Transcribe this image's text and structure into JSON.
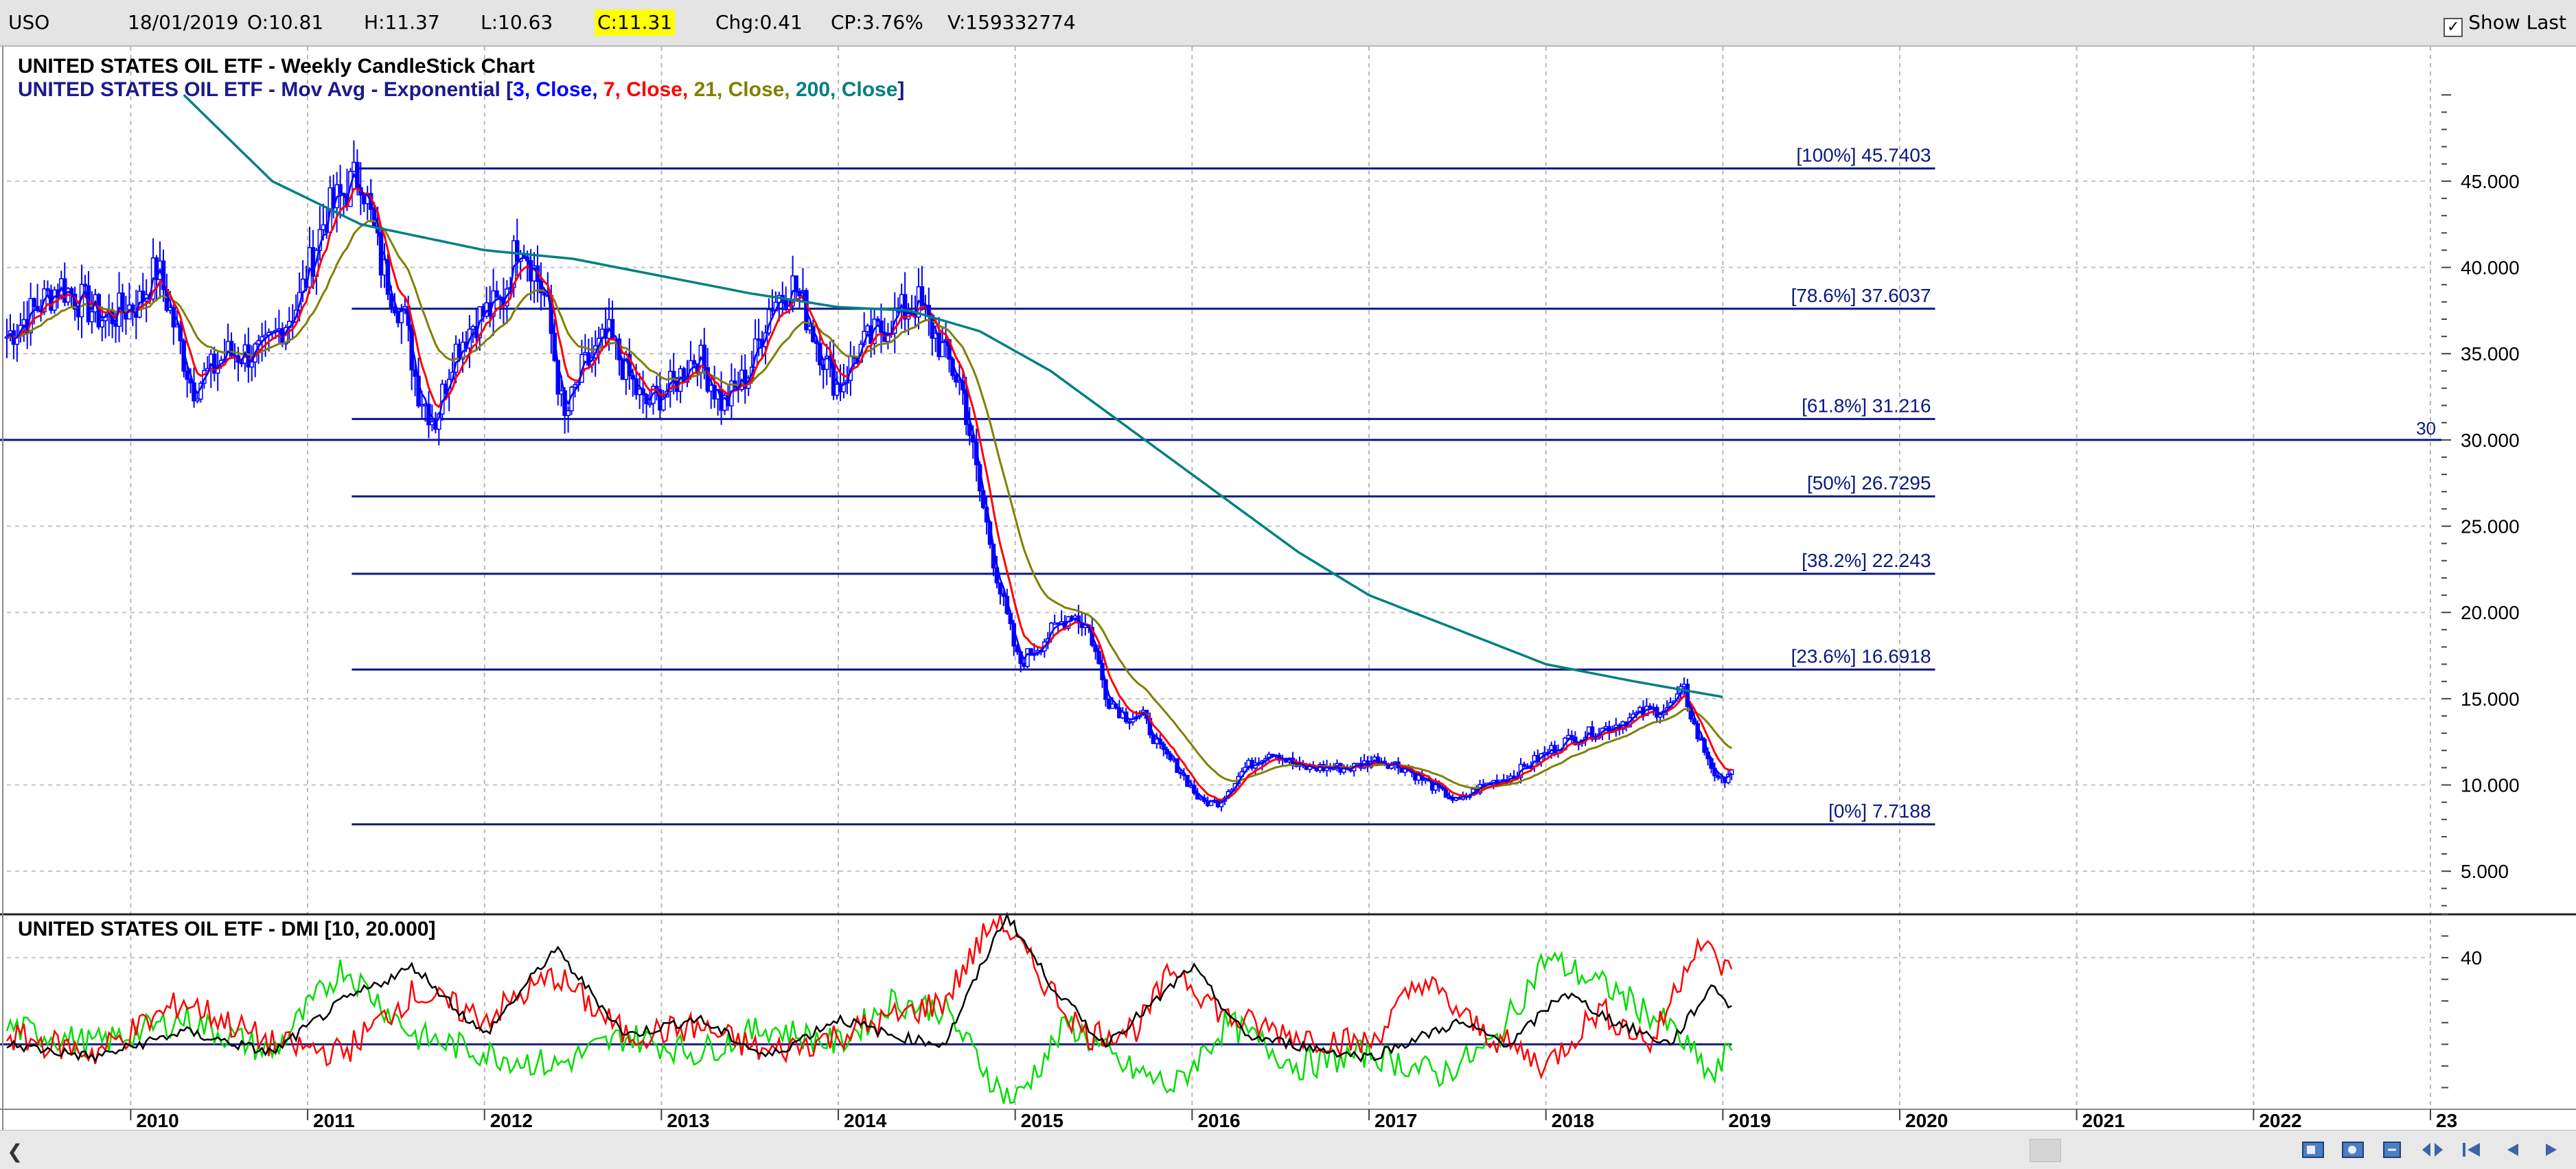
{
  "header": {
    "symbol": "USO",
    "date": "18/01/2019",
    "open": "O:10.81",
    "high": "H:11.37",
    "low": "L:10.63",
    "close": "C:11.31",
    "change": "Chg:0.41",
    "change_pct": "CP:3.76%",
    "volume": "V:159332774",
    "show_last_label": "Show Last",
    "show_last_checked": true
  },
  "colors": {
    "candles": "#0000ff",
    "ema3": "#0000ff",
    "ema7": "#ff0000",
    "ema21": "#808000",
    "ema200": "#008080",
    "fib": "#0a1a80",
    "dmi_plus": "#00dd00",
    "dmi_minus": "#ff0000",
    "adx": "#000000"
  },
  "chart_data": [
    {
      "type": "candlestick",
      "title": "UNITED STATES OIL ETF - Weekly CandleStick Chart",
      "overlay_label": {
        "prefix": "UNITED STATES OIL ETF - Mov Avg - Exponential [",
        "parts": [
          {
            "text": "3, Close, ",
            "color": "#0000ff"
          },
          {
            "text": "7, Close, ",
            "color": "#ff0000"
          },
          {
            "text": "21, Close, ",
            "color": "#808000"
          },
          {
            "text": "200, Close",
            "color": "#008080"
          }
        ],
        "suffix": "]"
      },
      "x_range": [
        2009.3,
        2023.0
      ],
      "ylim": [
        2.5,
        52
      ],
      "y_ticks": [
        5,
        10,
        15,
        20,
        25,
        30,
        35,
        40,
        45
      ],
      "y_tick_labels": [
        "5.000",
        "10.000",
        "15.000",
        "20.000",
        "25.000",
        "30.000",
        "35.000",
        "40.000",
        "45.000"
      ],
      "grid": true,
      "price_key_points": [
        [
          2009.3,
          36
        ],
        [
          2009.6,
          39
        ],
        [
          2009.85,
          37
        ],
        [
          2010.05,
          38
        ],
        [
          2010.15,
          40
        ],
        [
          2010.35,
          33
        ],
        [
          2010.55,
          35
        ],
        [
          2010.75,
          35
        ],
        [
          2010.95,
          38
        ],
        [
          2011.1,
          43
        ],
        [
          2011.3,
          45.5
        ],
        [
          2011.42,
          40
        ],
        [
          2011.55,
          37
        ],
        [
          2011.62,
          33
        ],
        [
          2011.72,
          31
        ],
        [
          2011.82,
          35
        ],
        [
          2011.95,
          37
        ],
        [
          2012.1,
          38
        ],
        [
          2012.2,
          42
        ],
        [
          2012.35,
          38
        ],
        [
          2012.45,
          31
        ],
        [
          2012.55,
          34
        ],
        [
          2012.7,
          36
        ],
        [
          2012.9,
          32
        ],
        [
          2013.05,
          33
        ],
        [
          2013.2,
          35
        ],
        [
          2013.35,
          32
        ],
        [
          2013.5,
          34
        ],
        [
          2013.62,
          38
        ],
        [
          2013.75,
          39
        ],
        [
          2013.95,
          34
        ],
        [
          2014.0,
          33
        ],
        [
          2014.1,
          35
        ],
        [
          2014.3,
          37
        ],
        [
          2014.45,
          38
        ],
        [
          2014.55,
          36
        ],
        [
          2014.7,
          33
        ],
        [
          2014.8,
          27
        ],
        [
          2014.92,
          21
        ],
        [
          2015.02,
          17
        ],
        [
          2015.12,
          18
        ],
        [
          2015.22,
          19
        ],
        [
          2015.32,
          20
        ],
        [
          2015.42,
          19
        ],
        [
          2015.52,
          15
        ],
        [
          2015.62,
          14
        ],
        [
          2015.72,
          14
        ],
        [
          2015.82,
          12
        ],
        [
          2015.92,
          11
        ],
        [
          2016.05,
          9
        ],
        [
          2016.15,
          9
        ],
        [
          2016.3,
          11
        ],
        [
          2016.45,
          12
        ],
        [
          2016.6,
          11
        ],
        [
          2016.75,
          11
        ],
        [
          2016.9,
          11
        ],
        [
          2017.05,
          11.5
        ],
        [
          2017.2,
          11
        ],
        [
          2017.35,
          10
        ],
        [
          2017.5,
          9
        ],
        [
          2017.65,
          10
        ],
        [
          2017.8,
          10.5
        ],
        [
          2017.95,
          11.5
        ],
        [
          2018.1,
          12.5
        ],
        [
          2018.25,
          13
        ],
        [
          2018.4,
          13.5
        ],
        [
          2018.55,
          14.2
        ],
        [
          2018.7,
          14.5
        ],
        [
          2018.78,
          15.5
        ],
        [
          2018.85,
          13
        ],
        [
          2018.92,
          11.5
        ],
        [
          2018.98,
          10
        ],
        [
          2019.05,
          11
        ]
      ],
      "ema200_key_points": [
        [
          2010.3,
          50
        ],
        [
          2010.8,
          45
        ],
        [
          2011.3,
          42.5
        ],
        [
          2012.0,
          41
        ],
        [
          2012.5,
          40.5
        ],
        [
          2013.0,
          39.5
        ],
        [
          2013.5,
          38.5
        ],
        [
          2014.0,
          37.7
        ],
        [
          2014.4,
          37.5
        ],
        [
          2014.8,
          36.3
        ],
        [
          2015.2,
          34
        ],
        [
          2015.6,
          31
        ],
        [
          2016.0,
          28
        ],
        [
          2016.6,
          23.5
        ],
        [
          2017.0,
          21
        ],
        [
          2017.5,
          19
        ],
        [
          2018.0,
          17
        ],
        [
          2018.5,
          16
        ],
        [
          2019.0,
          15.1
        ]
      ],
      "fibonacci_levels": [
        {
          "label": "[100%] 45.7403",
          "value": 45.7403
        },
        {
          "label": "[78.6%] 37.6037",
          "value": 37.6037
        },
        {
          "label": "[61.8%] 31.216",
          "value": 31.216
        },
        {
          "label": "[50%] 26.7295",
          "value": 26.7295
        },
        {
          "label": "[38.2%] 22.243",
          "value": 22.243
        },
        {
          "label": "[23.6%] 16.6918",
          "value": 16.6918
        },
        {
          "label": "[0%] 7.7188",
          "value": 7.7188
        }
      ],
      "fib_x_range": [
        2011.25,
        2020.2
      ],
      "horizontal_line": {
        "value": 30,
        "label": "30"
      }
    },
    {
      "type": "line",
      "title": "UNITED STATES OIL ETF - DMI [10, 20.000]",
      "ylim": [
        5,
        50
      ],
      "y_ticks": [
        40
      ],
      "y_tick_labels": [
        "40"
      ],
      "threshold": 20,
      "series_key_points": {
        "plus_di": [
          [
            2009.3,
            24
          ],
          [
            2009.8,
            20
          ],
          [
            2010.3,
            26
          ],
          [
            2010.8,
            18
          ],
          [
            2011.2,
            38
          ],
          [
            2011.6,
            22
          ],
          [
            2012.0,
            18
          ],
          [
            2012.4,
            15
          ],
          [
            2012.8,
            22
          ],
          [
            2013.2,
            18
          ],
          [
            2013.6,
            24
          ],
          [
            2014.0,
            20
          ],
          [
            2014.3,
            30
          ],
          [
            2014.6,
            28
          ],
          [
            2014.9,
            10
          ],
          [
            2015.0,
            7
          ],
          [
            2015.3,
            25
          ],
          [
            2015.6,
            15
          ],
          [
            2015.9,
            10
          ],
          [
            2016.2,
            25
          ],
          [
            2016.6,
            15
          ],
          [
            2017.0,
            18
          ],
          [
            2017.4,
            13
          ],
          [
            2017.7,
            20
          ],
          [
            2018.0,
            40
          ],
          [
            2018.4,
            32
          ],
          [
            2018.7,
            24
          ],
          [
            2018.95,
            12
          ],
          [
            2019.05,
            20
          ]
        ],
        "minus_di": [
          [
            2009.3,
            22
          ],
          [
            2009.8,
            18
          ],
          [
            2010.3,
            30
          ],
          [
            2010.8,
            20
          ],
          [
            2011.2,
            18
          ],
          [
            2011.6,
            32
          ],
          [
            2012.0,
            26
          ],
          [
            2012.4,
            36
          ],
          [
            2012.8,
            22
          ],
          [
            2013.2,
            24
          ],
          [
            2013.6,
            18
          ],
          [
            2014.0,
            22
          ],
          [
            2014.3,
            26
          ],
          [
            2014.6,
            30
          ],
          [
            2014.9,
            50
          ],
          [
            2015.1,
            38
          ],
          [
            2015.4,
            22
          ],
          [
            2015.7,
            24
          ],
          [
            2015.9,
            38
          ],
          [
            2016.2,
            26
          ],
          [
            2016.6,
            22
          ],
          [
            2017.0,
            20
          ],
          [
            2017.3,
            35
          ],
          [
            2017.6,
            24
          ],
          [
            2018.0,
            15
          ],
          [
            2018.3,
            28
          ],
          [
            2018.6,
            20
          ],
          [
            2018.85,
            44
          ],
          [
            2019.05,
            36
          ]
        ],
        "adx": [
          [
            2009.3,
            20
          ],
          [
            2009.8,
            17
          ],
          [
            2010.3,
            23
          ],
          [
            2010.8,
            18
          ],
          [
            2011.2,
            30
          ],
          [
            2011.6,
            38
          ],
          [
            2012.0,
            22
          ],
          [
            2012.4,
            42
          ],
          [
            2012.8,
            22
          ],
          [
            2013.2,
            26
          ],
          [
            2013.6,
            17
          ],
          [
            2014.0,
            26
          ],
          [
            2014.3,
            22
          ],
          [
            2014.6,
            20
          ],
          [
            2014.95,
            50
          ],
          [
            2015.2,
            34
          ],
          [
            2015.5,
            20
          ],
          [
            2015.8,
            30
          ],
          [
            2016.0,
            38
          ],
          [
            2016.3,
            22
          ],
          [
            2016.7,
            19
          ],
          [
            2017.0,
            17
          ],
          [
            2017.5,
            25
          ],
          [
            2017.8,
            20
          ],
          [
            2018.1,
            32
          ],
          [
            2018.4,
            25
          ],
          [
            2018.7,
            20
          ],
          [
            2018.95,
            34
          ],
          [
            2019.05,
            28
          ]
        ]
      }
    }
  ],
  "x_axis_labels": [
    "2010",
    "2011",
    "2012",
    "2013",
    "2014",
    "2015",
    "2016",
    "2017",
    "2018",
    "2019",
    "2020",
    "2021",
    "2022",
    "23"
  ],
  "x_axis_label_years": [
    2010,
    2011,
    2012,
    2013,
    2014,
    2015,
    2016,
    2017,
    2018,
    2019,
    2020,
    2021,
    2022,
    2023
  ]
}
